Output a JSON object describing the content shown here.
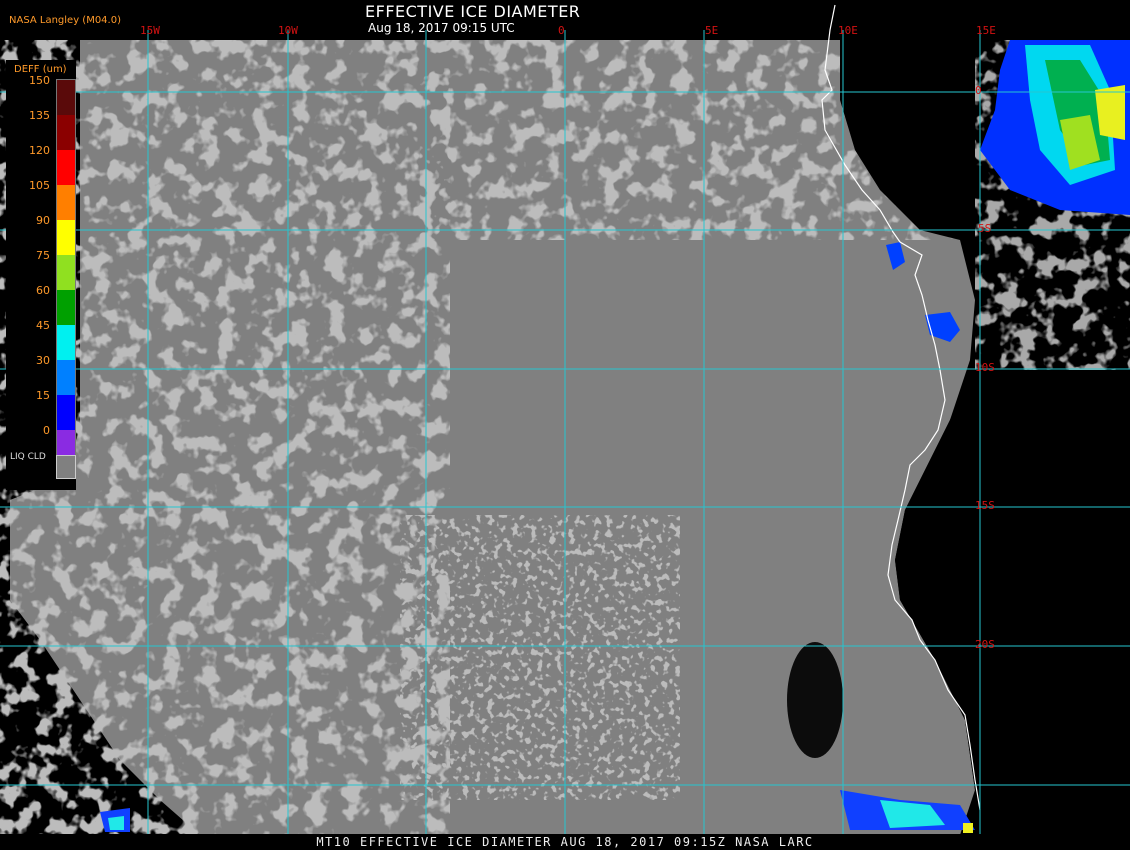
{
  "title": "EFFECTIVE ICE DIAMETER",
  "subtitle": "Aug 18, 2017 09:15 UTC",
  "credit": "NASA Langley (M04.0)",
  "footer": "MT10  EFFECTIVE ICE DIAMETER  AUG 18, 2017 09:15Z  NASA LARC",
  "longitude_labels": [
    "15W",
    "10W",
    "0",
    "5E",
    "10E",
    "15E"
  ],
  "latitude_labels": [
    "0",
    "5S",
    "10S",
    "15S",
    "20S"
  ],
  "legend": {
    "title": "DEFF (um)",
    "ticks": [
      "150",
      "135",
      "120",
      "105",
      "90",
      "75",
      "60",
      "45",
      "30",
      "15",
      "0"
    ],
    "colors": [
      "#5a0a0a",
      "#8b0000",
      "#ff0000",
      "#ff7f00",
      "#ffff00",
      "#90e020",
      "#00a000",
      "#00f0f0",
      "#0080ff",
      "#0000ff",
      "#8a2be2"
    ],
    "liquid_cloud_label": "LIQ CLD",
    "liquid_cloud_color": "#808080"
  },
  "colors": {
    "liquid_cloud": "#808080",
    "clear": "#000000",
    "grid": "#26c6d0",
    "coastline": "#ffffff",
    "label": "#d31212"
  }
}
